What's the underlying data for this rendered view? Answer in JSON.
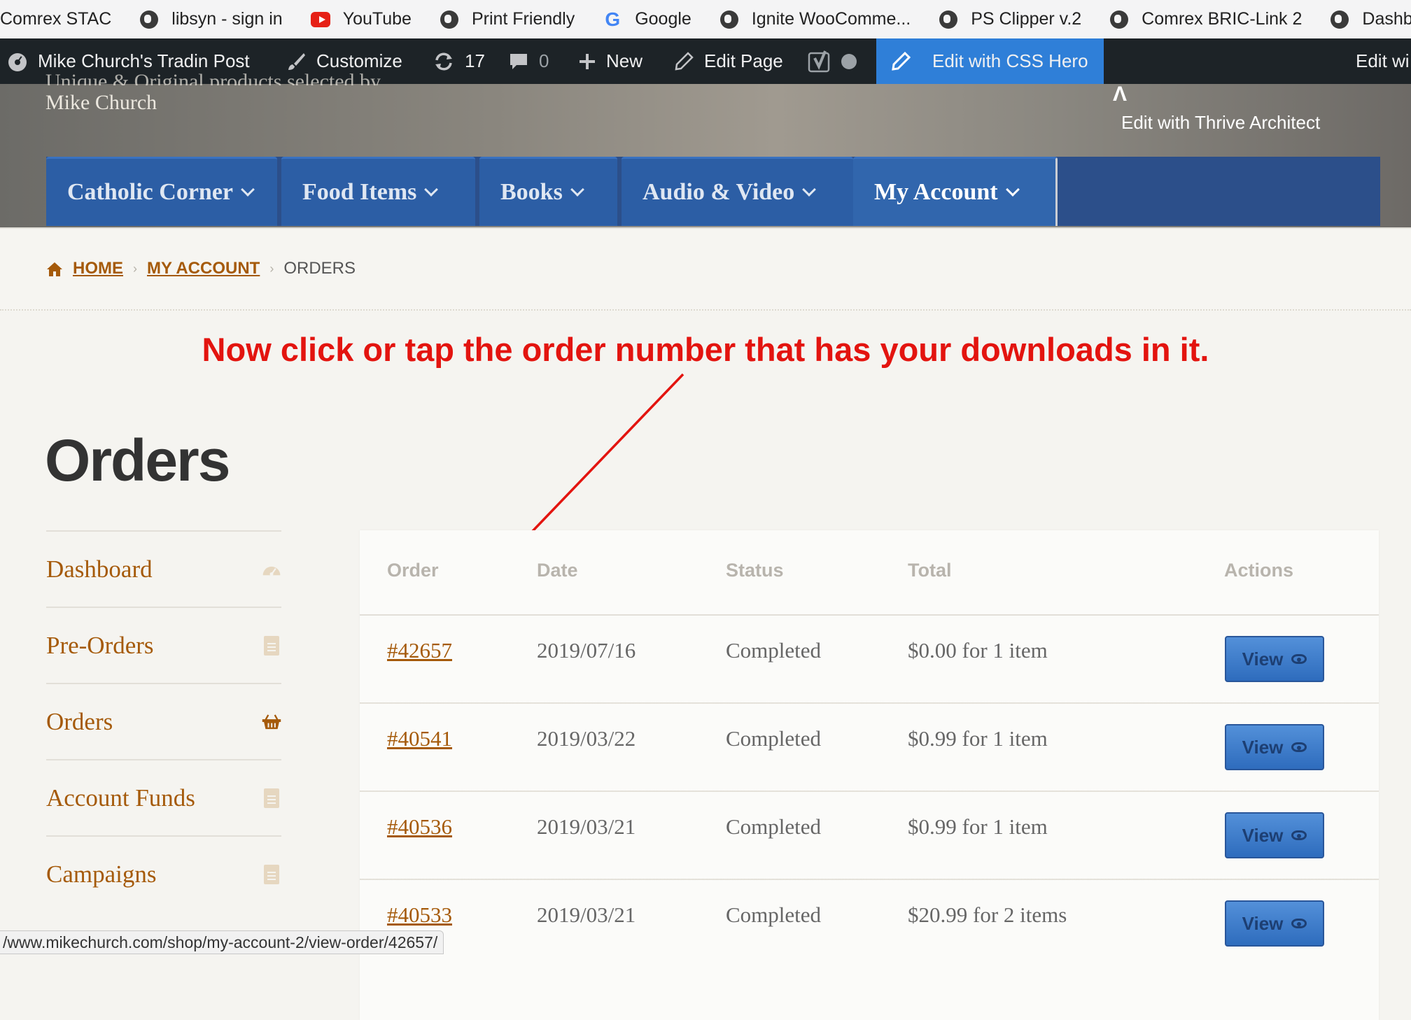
{
  "bookmarks": [
    {
      "label": "Comrex STAC",
      "icon": "none"
    },
    {
      "label": "libsyn - sign in",
      "icon": "globe-icon"
    },
    {
      "label": "YouTube",
      "icon": "youtube-icon"
    },
    {
      "label": "Print Friendly",
      "icon": "globe-icon"
    },
    {
      "label": "Google",
      "icon": "google-icon"
    },
    {
      "label": "Ignite WooComme...",
      "icon": "globe-icon"
    },
    {
      "label": "PS Clipper v.2",
      "icon": "globe-icon"
    },
    {
      "label": "Comrex BRIC-Link 2",
      "icon": "globe-icon"
    },
    {
      "label": "Dashboar",
      "icon": "globe-icon"
    }
  ],
  "adminbar": {
    "site_name": "Mike Church's Tradin Post",
    "customize": "Customize",
    "updates": "17",
    "comments": "0",
    "new": "New",
    "edit_page": "Edit Page",
    "css_hero": "Edit with CSS Hero",
    "edit_wi": "Edit wi"
  },
  "header": {
    "tagline_top": "Unique & Original products selected by",
    "tagline": "Mike Church",
    "thrive": "Edit with Thrive Architect"
  },
  "nav": {
    "items": [
      {
        "label": "Catholic Corner"
      },
      {
        "label": "Food Items"
      },
      {
        "label": "Books"
      },
      {
        "label": "Audio & Video"
      },
      {
        "label": "My Account"
      }
    ]
  },
  "breadcrumb": {
    "home": "HOME",
    "my_account": "MY ACCOUNT",
    "current": "ORDERS"
  },
  "annotation": "Now click or tap the order number that has your downloads in it.",
  "page_title": "Orders",
  "sidebar": {
    "items": [
      {
        "label": "Dashboard",
        "icon": "dashboard-gauge-icon"
      },
      {
        "label": "Pre-Orders",
        "icon": "document-icon"
      },
      {
        "label": "Orders",
        "icon": "basket-icon"
      },
      {
        "label": "Account Funds",
        "icon": "document-icon"
      },
      {
        "label": "Campaigns",
        "icon": "document-icon"
      }
    ]
  },
  "orders_table": {
    "headers": [
      "Order",
      "Date",
      "Status",
      "Total",
      "Actions"
    ],
    "rows": [
      {
        "order": "#42657",
        "date": "2019/07/16",
        "status": "Completed",
        "total": "$0.00 for 1 item",
        "action": "View"
      },
      {
        "order": "#40541",
        "date": "2019/03/22",
        "status": "Completed",
        "total": "$0.99 for 1 item",
        "action": "View"
      },
      {
        "order": "#40536",
        "date": "2019/03/21",
        "status": "Completed",
        "total": "$0.99 for 1 item",
        "action": "View"
      },
      {
        "order": "#40533",
        "date": "2019/03/21",
        "status": "Completed",
        "total": "$20.99 for 2 items",
        "action": "View"
      }
    ]
  },
  "status_url": "/www.mikechurch.com/shop/my-account-2/view-order/42657/",
  "colors": {
    "link": "#a55a0a",
    "nav_blue": "#2c5ea5",
    "annotation_red": "#e3140f",
    "admin_bar": "#1d2327",
    "css_hero_blue": "#2f7fd8"
  }
}
